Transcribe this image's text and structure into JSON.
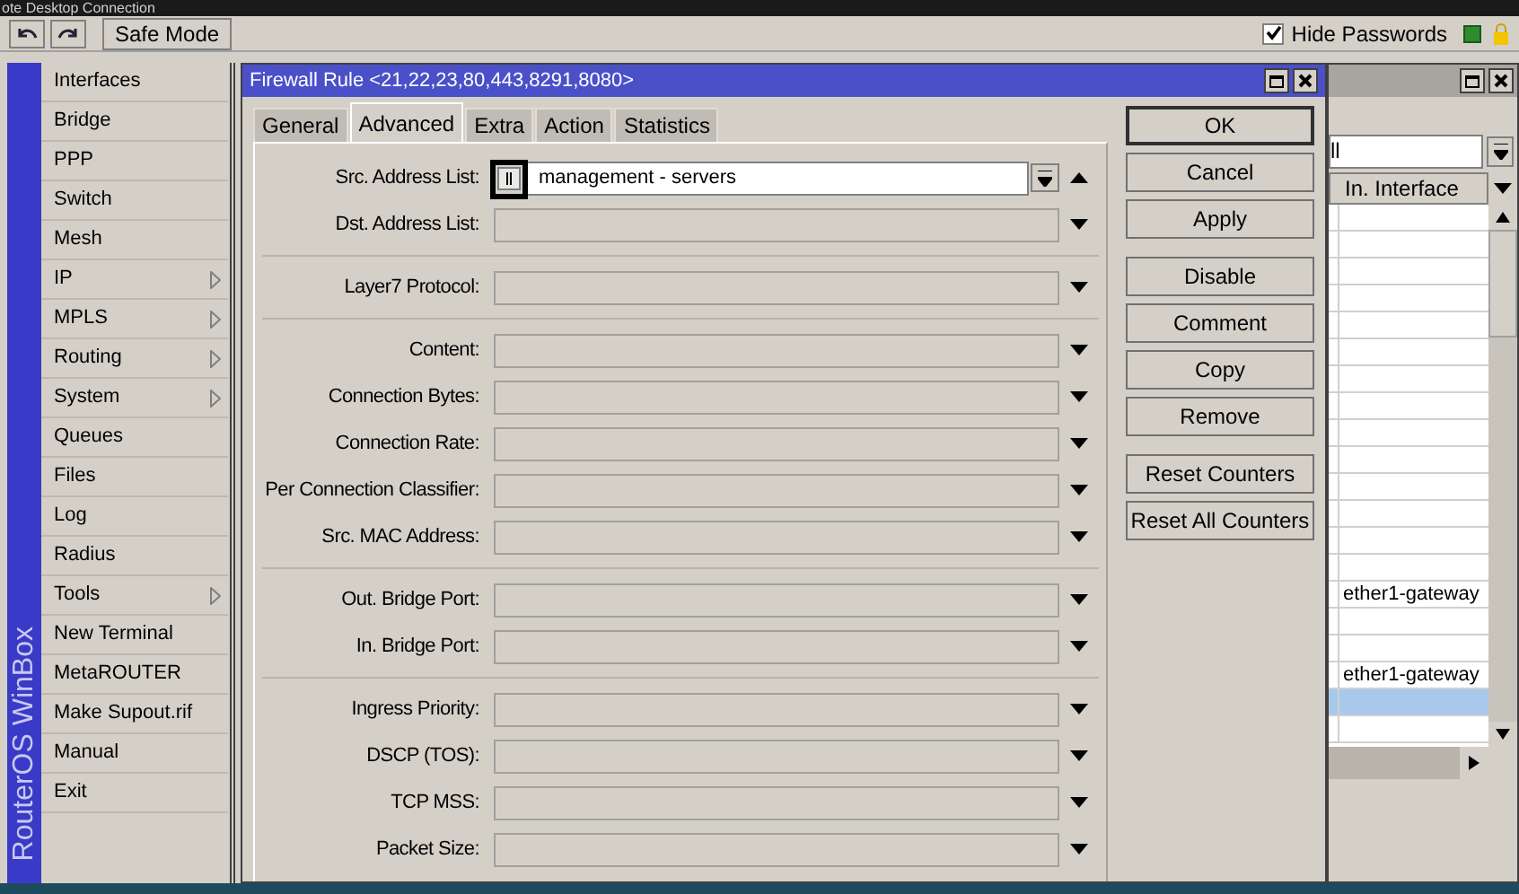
{
  "screen_title": "ote Desktop Connection",
  "toolbar": {
    "safe_mode": "Safe Mode",
    "hide_passwords": {
      "label": "Hide Passwords",
      "checked": true
    }
  },
  "side_banner": "RouterOS WinBox",
  "menu": [
    {
      "label": "Interfaces",
      "has_submenu": false
    },
    {
      "label": "Bridge",
      "has_submenu": false
    },
    {
      "label": "PPP",
      "has_submenu": false
    },
    {
      "label": "Switch",
      "has_submenu": false
    },
    {
      "label": "Mesh",
      "has_submenu": false
    },
    {
      "label": "IP",
      "has_submenu": true
    },
    {
      "label": "MPLS",
      "has_submenu": true
    },
    {
      "label": "Routing",
      "has_submenu": true
    },
    {
      "label": "System",
      "has_submenu": true
    },
    {
      "label": "Queues",
      "has_submenu": false
    },
    {
      "label": "Files",
      "has_submenu": false
    },
    {
      "label": "Log",
      "has_submenu": false
    },
    {
      "label": "Radius",
      "has_submenu": false
    },
    {
      "label": "Tools",
      "has_submenu": true
    },
    {
      "label": "New Terminal",
      "has_submenu": false
    },
    {
      "label": "MetaROUTER",
      "has_submenu": false
    },
    {
      "label": "Make Supout.rif",
      "has_submenu": false
    },
    {
      "label": "Manual",
      "has_submenu": false
    },
    {
      "label": "Exit",
      "has_submenu": false
    }
  ],
  "dialog": {
    "title": "Firewall Rule <21,22,23,80,443,8291,8080>",
    "tabs": [
      {
        "label": "General",
        "selected": false
      },
      {
        "label": "Advanced",
        "selected": true
      },
      {
        "label": "Extra",
        "selected": false
      },
      {
        "label": "Action",
        "selected": false
      },
      {
        "label": "Statistics",
        "selected": false
      }
    ],
    "field_groups": [
      [
        {
          "label": "Src. Address List:",
          "value": "management - servers",
          "warning": true,
          "expanded": true
        },
        {
          "label": "Dst. Address List:",
          "expanded": false
        }
      ],
      [
        {
          "label": "Layer7 Protocol:",
          "expanded": false
        }
      ],
      [
        {
          "label": "Content:",
          "expanded": false
        },
        {
          "label": "Connection Bytes:",
          "expanded": false
        },
        {
          "label": "Connection Rate:",
          "expanded": false
        },
        {
          "label": "Per Connection Classifier:",
          "expanded": false
        },
        {
          "label": "Src. MAC Address:",
          "expanded": false
        }
      ],
      [
        {
          "label": "Out. Bridge Port:",
          "expanded": false
        },
        {
          "label": "In. Bridge Port:",
          "expanded": false
        }
      ],
      [
        {
          "label": "Ingress Priority:",
          "expanded": false
        },
        {
          "label": "DSCP (TOS):",
          "expanded": false
        },
        {
          "label": "TCP MSS:",
          "expanded": false
        },
        {
          "label": "Packet Size:",
          "expanded": false
        }
      ]
    ],
    "button_groups": [
      [
        "OK",
        "Cancel",
        "Apply"
      ],
      [
        "Disable",
        "Comment",
        "Copy",
        "Remove"
      ],
      [
        "Reset Counters",
        "Reset All Counters"
      ]
    ]
  },
  "background_window": {
    "filter": "ll",
    "column": "In. Interface",
    "rows": [
      {
        "in_interface": "",
        "selected": false
      },
      {
        "in_interface": "",
        "selected": false
      },
      {
        "in_interface": "",
        "selected": false
      },
      {
        "in_interface": "",
        "selected": false
      },
      {
        "in_interface": "",
        "selected": false
      },
      {
        "in_interface": "",
        "selected": false
      },
      {
        "in_interface": "",
        "selected": false
      },
      {
        "in_interface": "",
        "selected": false
      },
      {
        "in_interface": "",
        "selected": false
      },
      {
        "in_interface": "",
        "selected": false
      },
      {
        "in_interface": "",
        "selected": false
      },
      {
        "in_interface": "",
        "selected": false
      },
      {
        "in_interface": "",
        "selected": false
      },
      {
        "in_interface": "",
        "selected": false
      },
      {
        "in_interface": "ether1-gateway",
        "selected": false
      },
      {
        "in_interface": "",
        "selected": false
      },
      {
        "in_interface": "",
        "selected": false
      },
      {
        "in_interface": "ether1-gateway",
        "selected": false
      },
      {
        "in_interface": "",
        "selected": true
      },
      {
        "in_interface": "",
        "selected": false
      }
    ]
  }
}
